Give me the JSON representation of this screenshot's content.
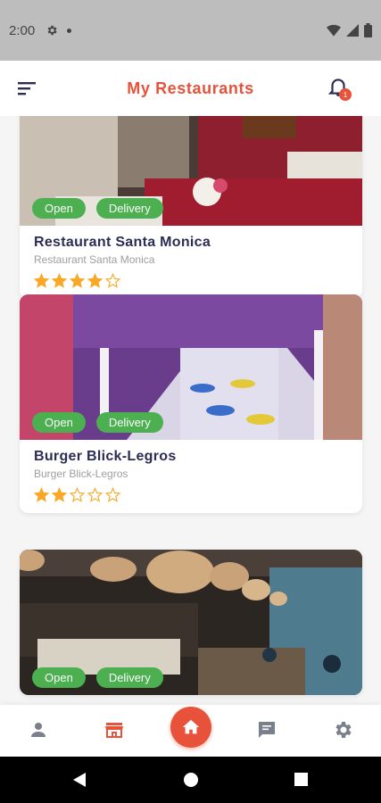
{
  "status_bar": {
    "time": "2:00",
    "icons": [
      "gear-icon",
      "dot-icon",
      "wifi-icon",
      "signal-icon",
      "battery-icon"
    ]
  },
  "header": {
    "title": "My Restaurants",
    "notification_count": "1"
  },
  "restaurants": [
    {
      "name": "Restaurant Santa Monica",
      "subtitle": "Restaurant Santa Monica",
      "tags": [
        "Open",
        "Delivery"
      ],
      "rating": 4,
      "max_rating": 5
    },
    {
      "name": "Burger Blick-Legros",
      "subtitle": "Burger Blick-Legros",
      "tags": [
        "Open",
        "Delivery"
      ],
      "rating": 2,
      "max_rating": 5
    },
    {
      "name": "",
      "subtitle": "",
      "tags": [
        "Open",
        "Delivery"
      ],
      "rating": 0,
      "max_rating": 5
    }
  ],
  "bottom_nav": {
    "items": [
      "person-icon",
      "store-icon",
      "home-icon",
      "chat-icon",
      "settings-icon"
    ],
    "active": "home-icon"
  },
  "colors": {
    "accent": "#e8523a",
    "tag_green": "#4caf50",
    "star": "#f9a825",
    "title_text": "#2c2c54"
  }
}
